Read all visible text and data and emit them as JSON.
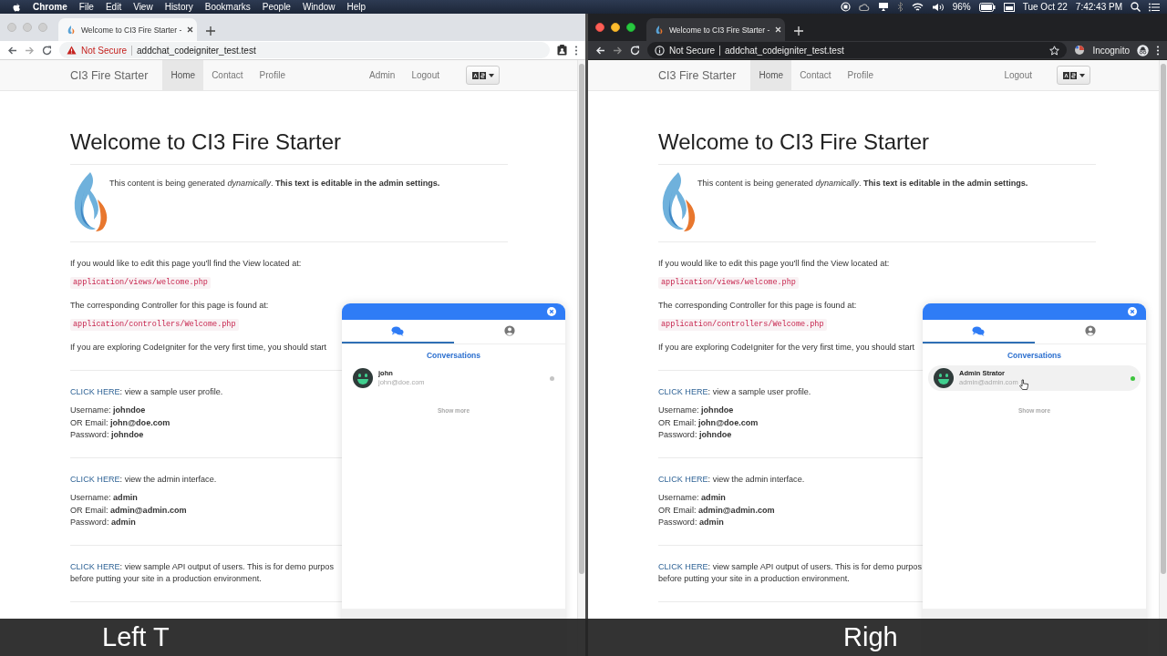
{
  "menu_bar": {
    "app": "Chrome",
    "menus": [
      "File",
      "Edit",
      "View",
      "History",
      "Bookmarks",
      "People",
      "Window",
      "Help"
    ],
    "battery": "96%",
    "date": "Tue Oct 22",
    "time": "7:42:43 PM"
  },
  "windows": [
    {
      "active": false,
      "incognito": false,
      "tab_title": "Welcome to CI3 Fire Starter -",
      "security": {
        "kind": "warning",
        "label": "Not Secure"
      },
      "url": "addchat_codeigniter_test.test",
      "navbar": {
        "brand": "CI3 Fire Starter",
        "items": [
          {
            "label": "Home",
            "selected": true
          },
          {
            "label": "Contact",
            "selected": false
          },
          {
            "label": "Profile",
            "selected": false
          }
        ],
        "right_items": [
          {
            "label": "Admin",
            "selected": false
          },
          {
            "label": "Logout",
            "selected": false
          }
        ]
      },
      "page": {
        "heading": "Welcome to CI3 Fire Starter",
        "intro": "This content is being generated *dynamically*. **This text is editable in the admin settings.**",
        "blocks": [
          {
            "kind": "text",
            "text": "If you would like to edit this page you'll find the View located at:"
          },
          {
            "kind": "code",
            "text": "application/views/welcome.php"
          },
          {
            "kind": "text",
            "text": "The corresponding Controller for this page is found at:"
          },
          {
            "kind": "code",
            "text": "application/controllers/Welcome.php"
          },
          {
            "kind": "text",
            "text": "If you are exploring CodeIgniter for the very first time, you should start"
          },
          {
            "kind": "rule"
          },
          {
            "kind": "link",
            "link": "CLICK HERE",
            "lines": [
              ": view a sample user profile."
            ]
          },
          {
            "kind": "lines",
            "lines": [
              "Username: **johndoe**",
              "OR Email: **john@doe.com**",
              "Password: **johndoe**"
            ]
          },
          {
            "kind": "rule"
          },
          {
            "kind": "link",
            "link": "CLICK HERE",
            "lines": [
              ": view the admin interface."
            ]
          },
          {
            "kind": "lines",
            "lines": [
              "Username: **admin**",
              "OR Email: **admin@admin.com**",
              "Password: **admin**"
            ]
          },
          {
            "kind": "rule"
          },
          {
            "kind": "link",
            "link": "CLICK HERE",
            "lines": [
              ": view sample API output of users. This is for demo purpos",
              "before putting your site in a production environment."
            ]
          },
          {
            "kind": "rule"
          }
        ]
      },
      "chat": {
        "tabs": [
          {
            "kind": "chats",
            "selected": true
          },
          {
            "kind": "profile",
            "selected": false
          }
        ],
        "title": "Conversations",
        "contacts": [
          {
            "name": "john",
            "email": "john@doe.com",
            "online": false,
            "hovered": false
          }
        ],
        "show_more": "Show more"
      },
      "caption": "Left T"
    },
    {
      "active": true,
      "incognito": true,
      "profile_label": "Incognito",
      "tab_title": "Welcome to CI3 Fire Starter -",
      "security": {
        "kind": "info",
        "label": "Not Secure"
      },
      "url": "addchat_codeigniter_test.test",
      "navbar": {
        "brand": "CI3 Fire Starter",
        "items": [
          {
            "label": "Home",
            "selected": true
          },
          {
            "label": "Contact",
            "selected": false
          },
          {
            "label": "Profile",
            "selected": false
          }
        ],
        "right_items": [
          {
            "label": "Logout",
            "selected": false
          }
        ]
      },
      "page": {
        "heading": "Welcome to CI3 Fire Starter",
        "intro": "This content is being generated *dynamically*. **This text is editable in the admin settings.**",
        "blocks": [
          {
            "kind": "text",
            "text": "If you would like to edit this page you'll find the View located at:"
          },
          {
            "kind": "code",
            "text": "application/views/welcome.php"
          },
          {
            "kind": "text",
            "text": "The corresponding Controller for this page is found at:"
          },
          {
            "kind": "code",
            "text": "application/controllers/Welcome.php"
          },
          {
            "kind": "text",
            "text": "If you are exploring CodeIgniter for the very first time, you should start"
          },
          {
            "kind": "rule"
          },
          {
            "kind": "link",
            "link": "CLICK HERE",
            "lines": [
              ": view a sample user profile."
            ]
          },
          {
            "kind": "lines",
            "lines": [
              "Username: **johndoe**",
              "OR Email: **john@doe.com**",
              "Password: **johndoe**"
            ]
          },
          {
            "kind": "rule"
          },
          {
            "kind": "link",
            "link": "CLICK HERE",
            "lines": [
              ": view the admin interface."
            ]
          },
          {
            "kind": "lines",
            "lines": [
              "Username: **admin**",
              "OR Email: **admin@admin.com**",
              "Password: **admin**"
            ]
          },
          {
            "kind": "rule"
          },
          {
            "kind": "link",
            "link": "CLICK HERE",
            "lines": [
              ": view sample API output of users. This is for demo purpos",
              "before putting your site in a production environment."
            ]
          },
          {
            "kind": "rule"
          }
        ]
      },
      "chat": {
        "tabs": [
          {
            "kind": "chats",
            "selected": true
          },
          {
            "kind": "profile",
            "selected": false
          }
        ],
        "title": "Conversations",
        "contacts": [
          {
            "name": "Admin Strator",
            "email": "admin@admin.com",
            "online": true,
            "hovered": true
          }
        ],
        "show_more": "Show more"
      },
      "caption": "Righ"
    }
  ]
}
